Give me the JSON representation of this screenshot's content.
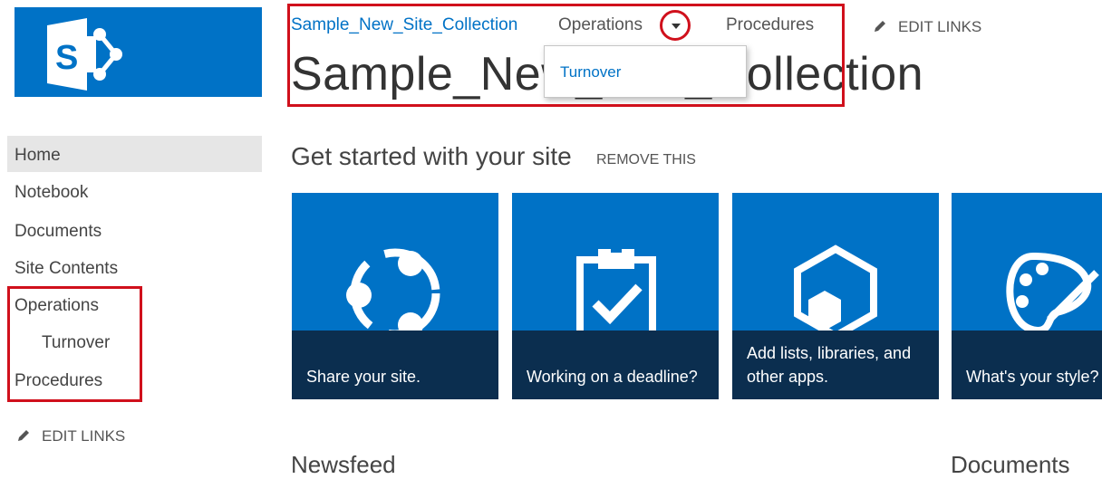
{
  "header": {
    "site_link": "Sample_New_Site_Collection",
    "nav": [
      "Operations",
      "Procedures"
    ],
    "edit_links": "EDIT LINKS",
    "site_title": "Sample_New_Site_Collection",
    "dropdown_item": "Turnover"
  },
  "left_nav": {
    "items": [
      "Home",
      "Notebook",
      "Documents",
      "Site Contents",
      "Operations",
      "Turnover",
      "Procedures"
    ],
    "edit_links": "EDIT LINKS"
  },
  "get_started": {
    "title": "Get started with your site",
    "remove": "REMOVE THIS",
    "tiles": [
      "Share your site.",
      "Working on a deadline?",
      "Add lists, libraries, and other apps.",
      "What's your style?"
    ]
  },
  "sections": {
    "newsfeed": "Newsfeed",
    "documents": "Documents"
  },
  "colors": {
    "accent": "#0072c6",
    "tile_band": "#0b2e4f",
    "highlight": "#d0101c"
  },
  "icons": [
    "sharepoint-logo-icon",
    "dropdown-arrow-icon",
    "pencil-icon",
    "share-icon",
    "clipboard-check-icon",
    "apps-hexagon-icon",
    "palette-icon"
  ]
}
